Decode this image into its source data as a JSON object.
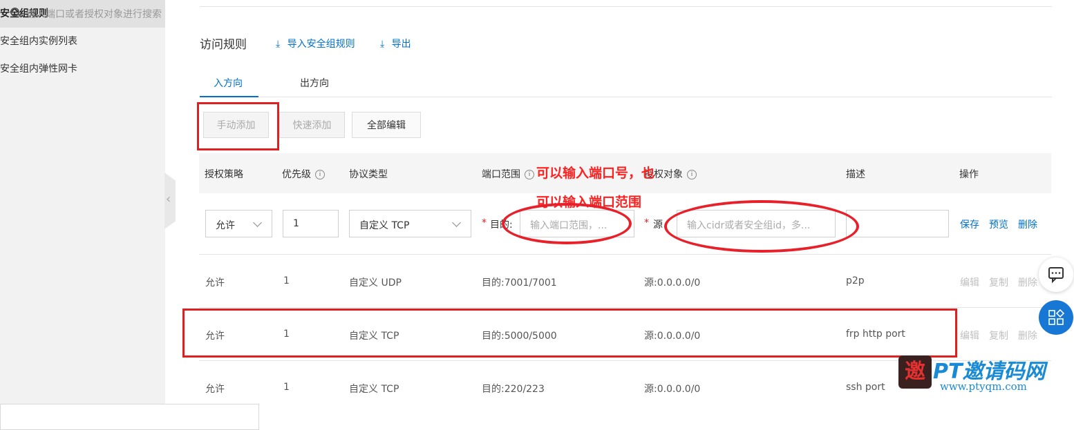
{
  "sidebar": {
    "items": [
      {
        "label": "安全组规则",
        "active": true
      },
      {
        "label": "安全组内实例列表",
        "active": false
      },
      {
        "label": "安全组内弹性网卡",
        "active": false
      }
    ]
  },
  "header": {
    "title": "访问规则",
    "import_label": "导入安全组规则",
    "export_label": "导出"
  },
  "tabs": [
    {
      "label": "入方向",
      "active": true
    },
    {
      "label": "出方向",
      "active": false
    }
  ],
  "toolbar": {
    "manual_add": "手动添加",
    "quick_add": "快速添加",
    "edit_all": "全部编辑",
    "search_placeholder": "输入端口或者授权对象进行搜索"
  },
  "table": {
    "columns": [
      "授权策略",
      "优先级",
      "协议类型",
      "端口范围",
      "授权对象",
      "描述",
      "操作"
    ],
    "edit_row": {
      "policy": "允许",
      "priority": "1",
      "protocol": "自定义 TCP",
      "dest_label": "目的:",
      "dest_placeholder": "输入端口范围，...",
      "source_label": "源",
      "source_placeholder": "输入cidr或者安全组id，多...",
      "required_mark": "*",
      "actions": [
        "保存",
        "预览",
        "删除"
      ]
    },
    "rows": [
      {
        "policy": "允许",
        "priority": "1",
        "protocol": "自定义 UDP",
        "port": "目的:7001/7001",
        "source": "源:0.0.0.0/0",
        "desc": "p2p"
      },
      {
        "policy": "允许",
        "priority": "1",
        "protocol": "自定义 TCP",
        "port": "目的:5000/5000",
        "source": "源:0.0.0.0/0",
        "desc": "frp http port"
      },
      {
        "policy": "允许",
        "priority": "1",
        "protocol": "自定义 TCP",
        "port": "目的:220/223",
        "source": "源:0.0.0.0/0",
        "desc": "ssh port"
      }
    ],
    "row_actions": [
      "编辑",
      "复制",
      "删除"
    ]
  },
  "annotations": {
    "line1": "可以输入端口号，也",
    "line2": "可以输入端口范围"
  },
  "watermark": {
    "brand": "PT邀请码网",
    "url": "www.ptyqm.com",
    "seal": "邀"
  },
  "colors": {
    "accent": "#0070cc",
    "annotation": "#e02020"
  }
}
